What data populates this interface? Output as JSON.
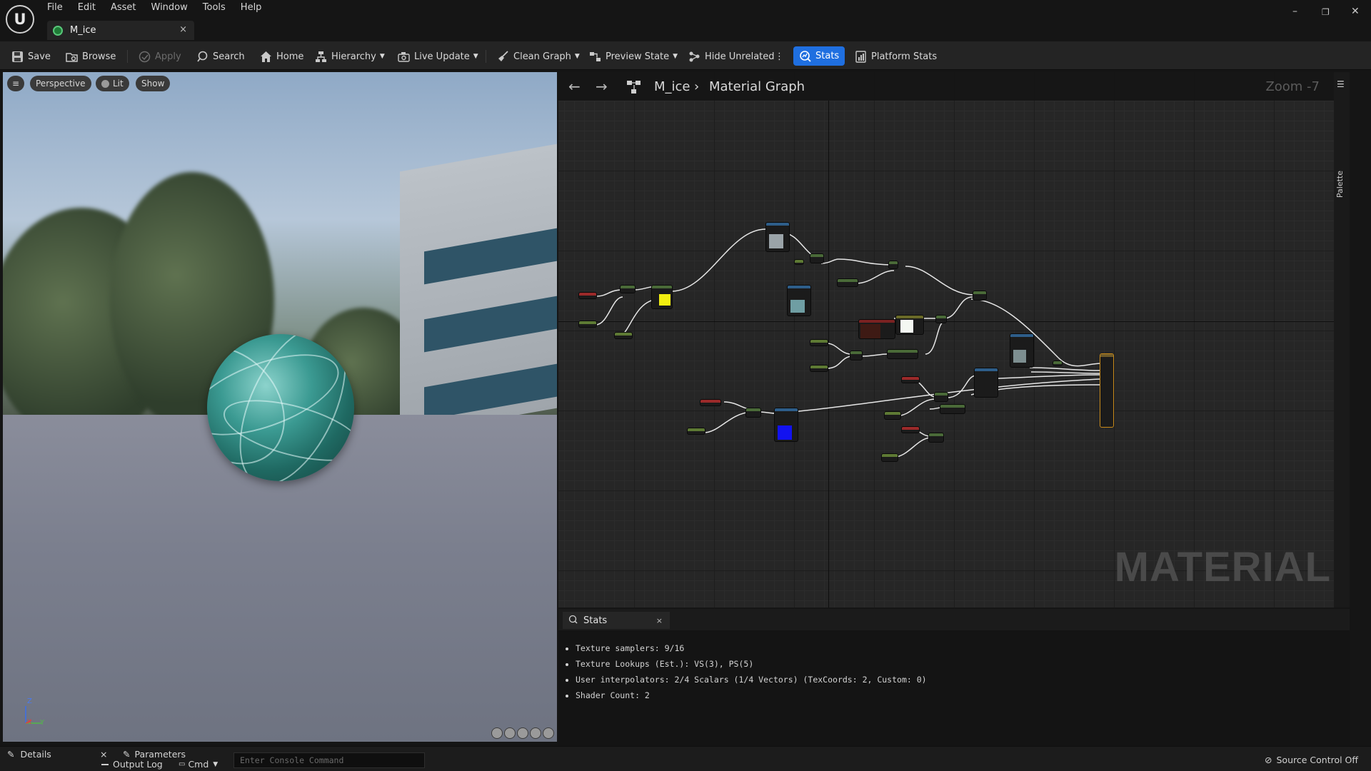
{
  "app": {
    "logo_text": "U"
  },
  "menu": [
    "File",
    "Edit",
    "Asset",
    "Window",
    "Tools",
    "Help"
  ],
  "document_tab": {
    "label": "M_ice",
    "close": "×"
  },
  "window_controls": {
    "minimize": "–",
    "restore": "❐",
    "close": "✕"
  },
  "toolbar": {
    "save": "Save",
    "browse": "Browse",
    "apply": "Apply",
    "search": "Search",
    "home": "Home",
    "hierarchy": "Hierarchy",
    "live_update": "Live Update",
    "clean_graph": "Clean Graph",
    "preview_state": "Preview State",
    "hide_unrelated": "Hide Unrelated",
    "more": "⋮",
    "stats": "Stats",
    "platform_stats": "Platform Stats"
  },
  "viewport": {
    "menu_icon": "≡",
    "perspective": "Perspective",
    "lit": "Lit",
    "show": "Show",
    "axis_z": "Z",
    "axis_x": "X",
    "axis_y": "Y"
  },
  "graph": {
    "back": "←",
    "forward": "→",
    "breadcrumb_asset": "M_ice",
    "breadcrumb_sep": "›",
    "breadcrumb_graph": "Material Graph",
    "zoom": "Zoom -7",
    "watermark": "MATERIAL",
    "palette": "Palette",
    "palette_menu": "☰"
  },
  "stats": {
    "tab": "Stats",
    "close": "×",
    "lines": [
      "Texture samplers: 9/16",
      "Texture Lookups (Est.): VS(3), PS(5)",
      "User interpolators: 2/4 Scalars (1/4 Vectors) (TexCoords: 2, Custom: 0)",
      "Shader Count: 2"
    ]
  },
  "bottom": {
    "details": "Details",
    "details_close": "×",
    "parameters": "Parameters",
    "output_log": "Output Log",
    "cmd": "Cmd",
    "console_placeholder": "Enter Console Command",
    "source_control": "Source Control Off"
  },
  "colors": {
    "accent": "#1f6fe0",
    "panel": "#242424",
    "graph_bg": "#262626"
  }
}
